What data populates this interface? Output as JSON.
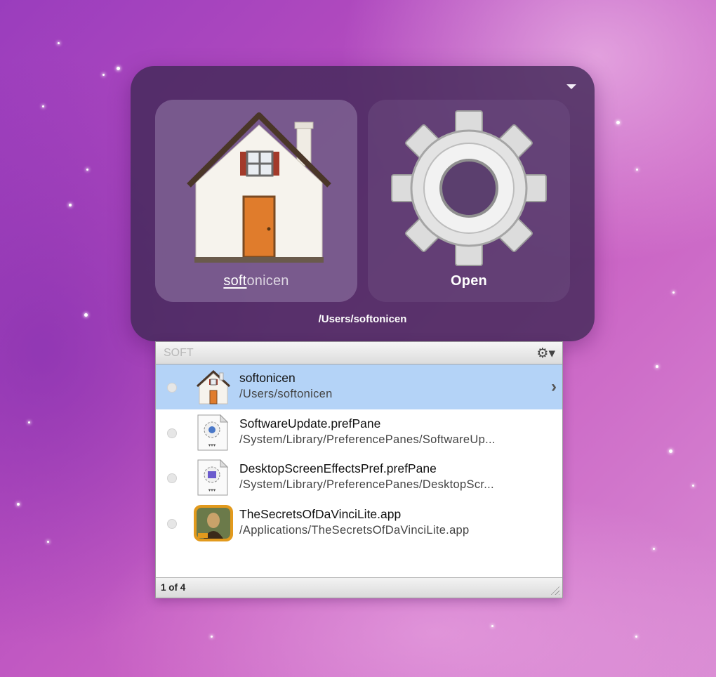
{
  "hud": {
    "selected_item": {
      "label_typed": "soft",
      "label_rest": "onicen",
      "icon": "home-folder-icon"
    },
    "action": {
      "label": "Open",
      "icon": "gear-action-icon"
    },
    "path": "/Users/softonicen",
    "menu_icon": "triangle-down-icon"
  },
  "results": {
    "query": "SOFT",
    "options_icon": "gear-icon",
    "items": [
      {
        "name": "softonicen",
        "path": "/Users/softonicen",
        "icon": "home-folder-icon",
        "selected": true
      },
      {
        "name": "SoftwareUpdate.prefPane",
        "path": "/System/Library/PreferencePanes/SoftwareUp...",
        "icon": "prefpane-file-icon"
      },
      {
        "name": "DesktopScreenEffectsPref.prefPane",
        "path": "/System/Library/PreferencePanes/DesktopScr...",
        "icon": "prefpane-file-icon"
      },
      {
        "name": "TheSecretsOfDaVinciLite.app",
        "path": "/Applications/TheSecretsOfDaVinciLite.app",
        "icon": "mona-lisa-app-icon"
      }
    ],
    "count": "1 of 4"
  }
}
